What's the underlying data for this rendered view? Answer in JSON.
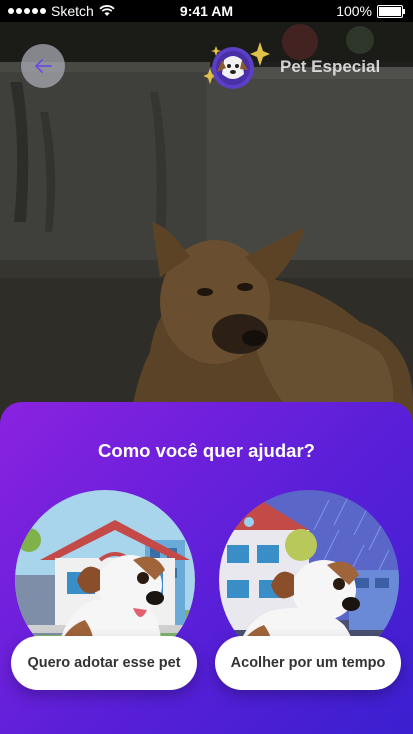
{
  "status_bar": {
    "carrier": "Sketch",
    "time": "9:41 AM",
    "battery": "100%"
  },
  "header": {
    "back_icon": "arrow-left-icon",
    "brand_name": "Pet Especial"
  },
  "help_panel": {
    "title": "Como você quer ajudar?",
    "options": [
      {
        "label": "Quero adotar esse pet",
        "illustration": "dog-house-illustration"
      },
      {
        "label": "Acolher por um tempo",
        "illustration": "dog-rain-illustration"
      }
    ]
  },
  "colors": {
    "panel_gradient_start": "#8a22e0",
    "panel_gradient_end": "#3b1fd0",
    "button_bg": "#ffffff",
    "button_text": "#333333"
  }
}
